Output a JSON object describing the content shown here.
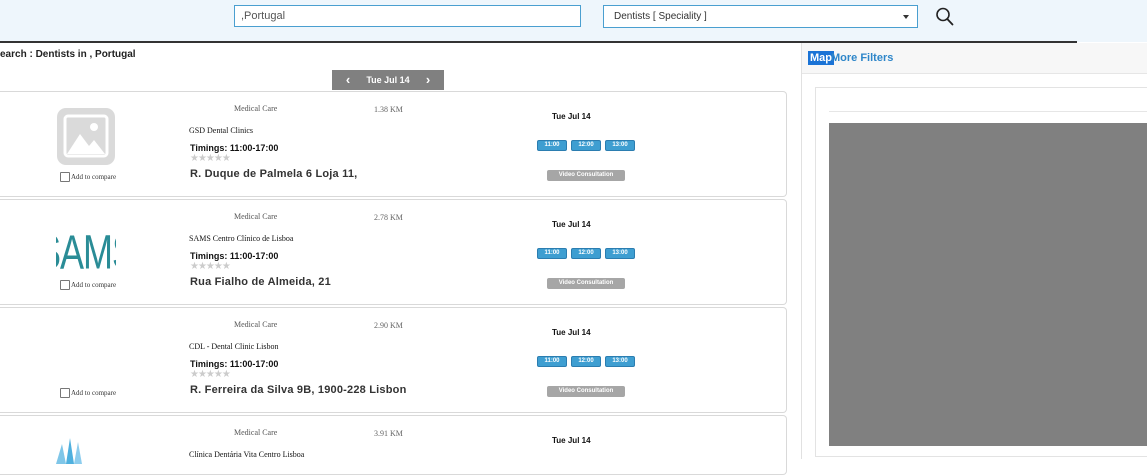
{
  "search": {
    "location_value": ",Portugal",
    "speciality_value": "Dentists [ Speciality ]"
  },
  "breadcrumb": "earch : Dentists in , Portugal",
  "date_nav": {
    "label": "Tue Jul 14",
    "prev": "‹",
    "next": "›"
  },
  "right_panel": {
    "map_tab": "Map",
    "more_filters": "More Filters"
  },
  "clinics": [
    {
      "category": "Medical Care",
      "distance": "1.38 KM",
      "name": "GSD Dental Clinics",
      "timings": "Timings: 11:00-17:00",
      "address": "R. Duque de Palmela 6 Loja 11,",
      "day": "Tue Jul 14",
      "slots": [
        "11:00",
        "12:00",
        "13:00"
      ],
      "video": "Video Consultation",
      "compare": "Add to compare",
      "rating": 0,
      "logo": "placeholder-image-icon"
    },
    {
      "category": "Medical Care",
      "distance": "2.78 KM",
      "name": "SAMS Centro Clínico de Lisboa",
      "timings": "Timings: 11:00-17:00",
      "address": "Rua Fialho de Almeida, 21",
      "day": "Tue Jul 14",
      "slots": [
        "11:00",
        "12:00",
        "13:00"
      ],
      "video": "Video Consultation",
      "compare": "Add to compare",
      "rating": 0,
      "logo": "sams-logo",
      "logo_text": "SAMS"
    },
    {
      "category": "Medical Care",
      "distance": "2.90 KM",
      "name": "CDL - Dental Clinic Lisbon",
      "timings": "Timings: 11:00-17:00",
      "address": "R. Ferreira da Silva 9B, 1900-228 Lisbon",
      "day": "Tue Jul 14",
      "slots": [
        "11:00",
        "12:00",
        "13:00"
      ],
      "video": "Video Consultation",
      "compare": "Add to compare",
      "rating": 0,
      "logo": "none"
    },
    {
      "category": "Medical Care",
      "distance": "3.91 KM",
      "name": "Clínica Dentária Vita Centro Lisboa",
      "day": "Tue Jul 14",
      "logo": "vita-logo"
    }
  ],
  "colors": {
    "slot_blue": "#3e9ed1",
    "map_gray": "#808080",
    "header_bg": "#eef6fc",
    "link_blue": "#2e86c9"
  }
}
